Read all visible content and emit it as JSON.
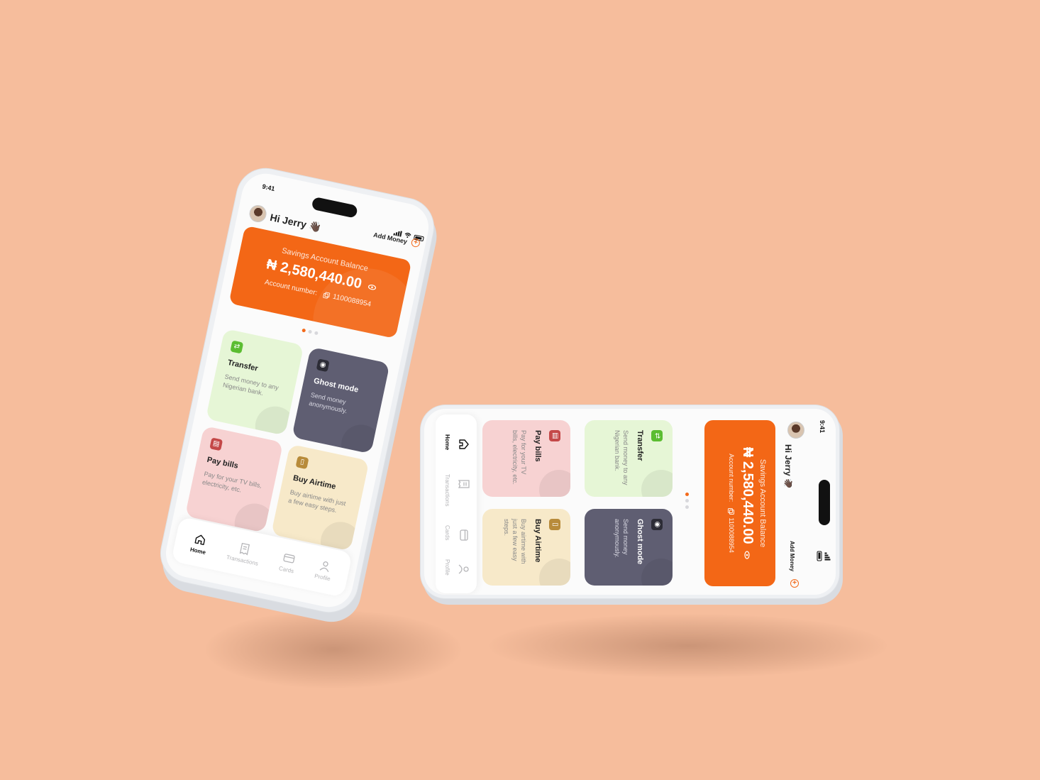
{
  "status": {
    "time": "9:41"
  },
  "user": {
    "greeting": "Hi Jerry 👋🏿"
  },
  "actions": {
    "add_money": "Add Money",
    "add_icon": "plus-circle-icon"
  },
  "balance_card": {
    "label": "Savings Account Balance",
    "amount": "₦ 2,580,440.00",
    "account_label": "Account number:",
    "account_number": "1100088954",
    "eye_icon": "eye-icon",
    "copy_icon": "copy-icon"
  },
  "tiles": {
    "transfer": {
      "title": "Transfer",
      "desc": "Send money to any Nigerian bank.",
      "icon": "transfer-icon",
      "color": "#e6f6d6"
    },
    "ghost": {
      "title": "Ghost mode",
      "desc": "Send money anonymously.",
      "icon": "ghost-icon",
      "color": "#5f5e72"
    },
    "bills": {
      "title": "Pay bills",
      "desc": "Pay for your TV bills, electricity, etc.",
      "icon": "bill-icon",
      "color": "#f7d2d2"
    },
    "airtime": {
      "title": "Buy Airtime",
      "desc": "Buy airtime with just a few easy steps.",
      "icon": "phone-icon",
      "color": "#f7e9c9"
    }
  },
  "nav": [
    {
      "label": "Home",
      "icon": "home-icon",
      "active": true
    },
    {
      "label": "Transactions",
      "icon": "receipt-icon",
      "active": false
    },
    {
      "label": "Cards",
      "icon": "card-icon",
      "active": false
    },
    {
      "label": "Profile",
      "icon": "profile-icon",
      "active": false
    }
  ],
  "colors": {
    "background": "#f6bd9c",
    "accent": "#f36716"
  }
}
